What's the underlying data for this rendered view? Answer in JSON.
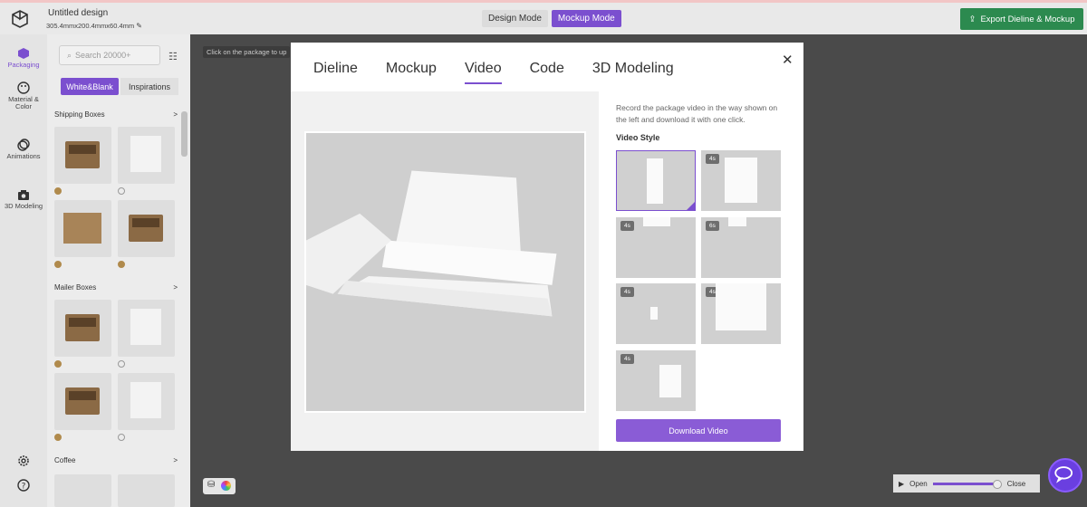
{
  "app": {
    "logo_icon": "cube-logo-icon",
    "title": "Untitled design",
    "dimensions": "305.4mmx200.4mmx60.4mm",
    "modes": [
      "Design Mode",
      "Mockup Mode"
    ],
    "active_mode": "Mockup Mode",
    "export_label": "Export Dieline & Mockup"
  },
  "rail": {
    "items": [
      {
        "label": "Packaging",
        "icon": "box-icon"
      },
      {
        "label": "Material & Color",
        "icon": "palette-icon"
      },
      {
        "label": "Animations",
        "icon": "animation-icon"
      },
      {
        "label": "3D Modeling",
        "icon": "camera-icon"
      }
    ],
    "settings_icon": "gear-icon",
    "help_icon": "help-icon"
  },
  "panel": {
    "search_placeholder": "Search 20000+",
    "tabs": [
      "White&Blank",
      "Inspirations"
    ],
    "categories": [
      {
        "name": "Shipping Boxes",
        "chevron": ">"
      },
      {
        "name": "Mailer Boxes",
        "chevron": ">"
      },
      {
        "name": "Coffee",
        "chevron": ">"
      }
    ],
    "thumb_text": "YOUR DESIGN HERE"
  },
  "canvas": {
    "hint": "Click on the package to up",
    "player_open": "Open",
    "player_close": "Close"
  },
  "modal": {
    "tabs": [
      "Dieline",
      "Mockup",
      "Video",
      "Code",
      "3D Modeling"
    ],
    "active_tab": "Video",
    "description": "Record the package video in the way shown on the left and download it with one click.",
    "video_style_label": "Video Style",
    "styles": [
      "",
      "4s",
      "4s",
      "6s",
      "4s",
      "4s",
      "4s"
    ],
    "download_label": "Download Video"
  },
  "colors": {
    "accent": "#7b4fcf",
    "export_green": "#2c8a4f",
    "chat": "#6a3fe0"
  }
}
